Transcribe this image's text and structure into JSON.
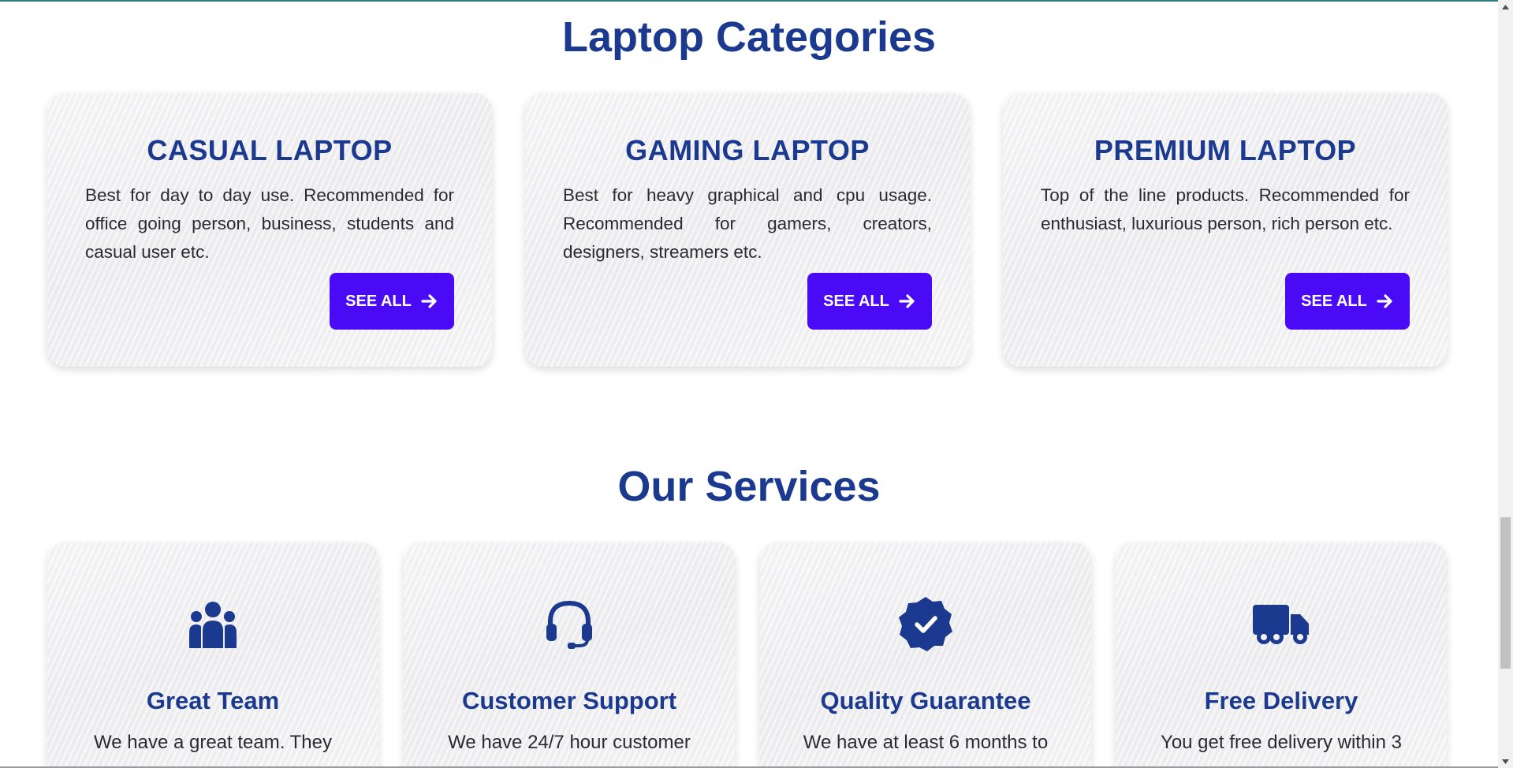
{
  "categories": {
    "title": "Laptop Categories",
    "items": [
      {
        "title": "CASUAL LAPTOP",
        "description": "Best for day to day use. Recommended for office going person, business, students and casual user etc.",
        "button": "SEE ALL"
      },
      {
        "title": "GAMING LAPTOP",
        "description": "Best for heavy graphical and cpu usage. Recommended for gamers, creators, designers, streamers etc.",
        "button": "SEE ALL"
      },
      {
        "title": "PREMIUM LAPTOP",
        "description": "Top of the line products. Recommended for enthusiast, luxurious person, rich person etc.",
        "button": "SEE ALL"
      }
    ]
  },
  "services": {
    "title": "Our Services",
    "items": [
      {
        "icon": "team-icon",
        "title": "Great Team",
        "description": "We have a great team. They"
      },
      {
        "icon": "headset-icon",
        "title": "Customer Support",
        "description": "We have 24/7 hour customer"
      },
      {
        "icon": "verified-badge-icon",
        "title": "Quality Guarantee",
        "description": "We have at least 6 months to"
      },
      {
        "icon": "truck-icon",
        "title": "Free Delivery",
        "description": "You get free delivery within 3"
      }
    ]
  },
  "colors": {
    "heading": "#1b3a8f",
    "button": "#4b0af5",
    "text": "#2a2a33"
  }
}
